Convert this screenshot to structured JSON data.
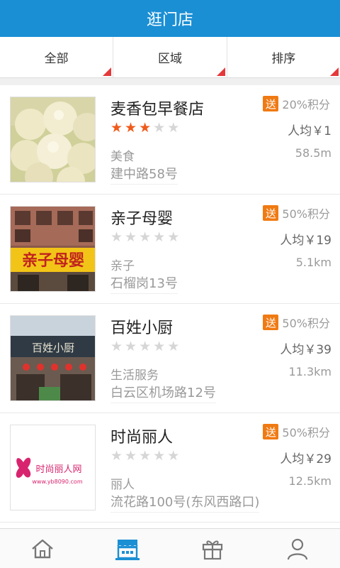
{
  "header": {
    "title": "逛门店"
  },
  "filters": [
    {
      "label": "全部"
    },
    {
      "label": "区域"
    },
    {
      "label": "排序"
    }
  ],
  "stores": [
    {
      "name": "麦香包早餐店",
      "rating": 3,
      "category": "美食",
      "address": "建中路58号",
      "badge": "送",
      "promo": "20%积分",
      "price": "人均￥1",
      "distance": "58.5m",
      "image_icon": "steamed-buns-photo"
    },
    {
      "name": "亲子母婴",
      "rating": 0,
      "category": "亲子",
      "address": "石榴岗13号",
      "badge": "送",
      "promo": "50%积分",
      "price": "人均￥19",
      "distance": "5.1km",
      "image_icon": "storefront-photo",
      "sign_text": "亲子母婴"
    },
    {
      "name": "百姓小厨",
      "rating": 0,
      "category": "生活服务",
      "address": "白云区机场路12号",
      "badge": "送",
      "promo": "50%积分",
      "price": "人均￥39",
      "distance": "11.3km",
      "image_icon": "restaurant-front-photo",
      "sign_text": "百姓小厨"
    },
    {
      "name": "时尚丽人",
      "rating": 0,
      "category": "丽人",
      "address": "流花路100号(东风西路口)",
      "badge": "送",
      "promo": "50%积分",
      "price": "人均￥29",
      "distance": "12.5km",
      "image_icon": "logo-image",
      "logo_text": "时尚丽人网",
      "logo_url": "www.yb8090.com"
    }
  ],
  "tabbar": [
    {
      "icon": "home-icon",
      "active": false
    },
    {
      "icon": "store-icon",
      "active": true
    },
    {
      "icon": "gift-icon",
      "active": false
    },
    {
      "icon": "person-icon",
      "active": false
    }
  ],
  "colors": {
    "primary": "#1a8fd4",
    "star_on": "#f05a1a",
    "badge": "#f07a12",
    "corner": "#e5383b"
  }
}
